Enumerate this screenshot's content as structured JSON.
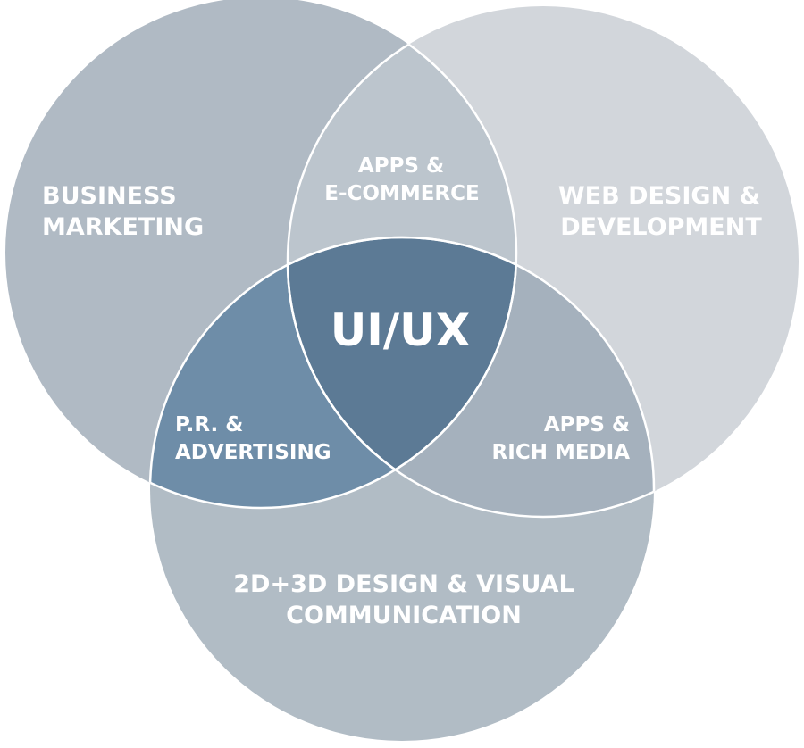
{
  "diagram": {
    "circles": {
      "business_marketing": {
        "line1": "BUSINESS",
        "line2": "MARKETING",
        "color": "#b0bac4"
      },
      "web_design_development": {
        "line1": "WEB DESIGN &",
        "line2": "DEVELOPMENT",
        "color": "#d2d6db"
      },
      "visual_communication": {
        "line1": "2D+3D DESIGN & VISUAL",
        "line2": "COMMUNICATION",
        "color": "#b1bcc5"
      }
    },
    "intersections": {
      "apps_ecommerce": {
        "line1": "APPS &",
        "line2": "E-COMMERCE",
        "color": "#bcc5cd"
      },
      "pr_advertising": {
        "line1": "P.R. &",
        "line2": "ADVERTISING",
        "color": "#6e8da8"
      },
      "apps_rich_media": {
        "line1": "APPS &",
        "line2": "RICH MEDIA",
        "color": "#a5b1bd"
      }
    },
    "center": {
      "label": "UI/UX",
      "color": "#5c7a95"
    },
    "outline_color": "#ffffff"
  }
}
